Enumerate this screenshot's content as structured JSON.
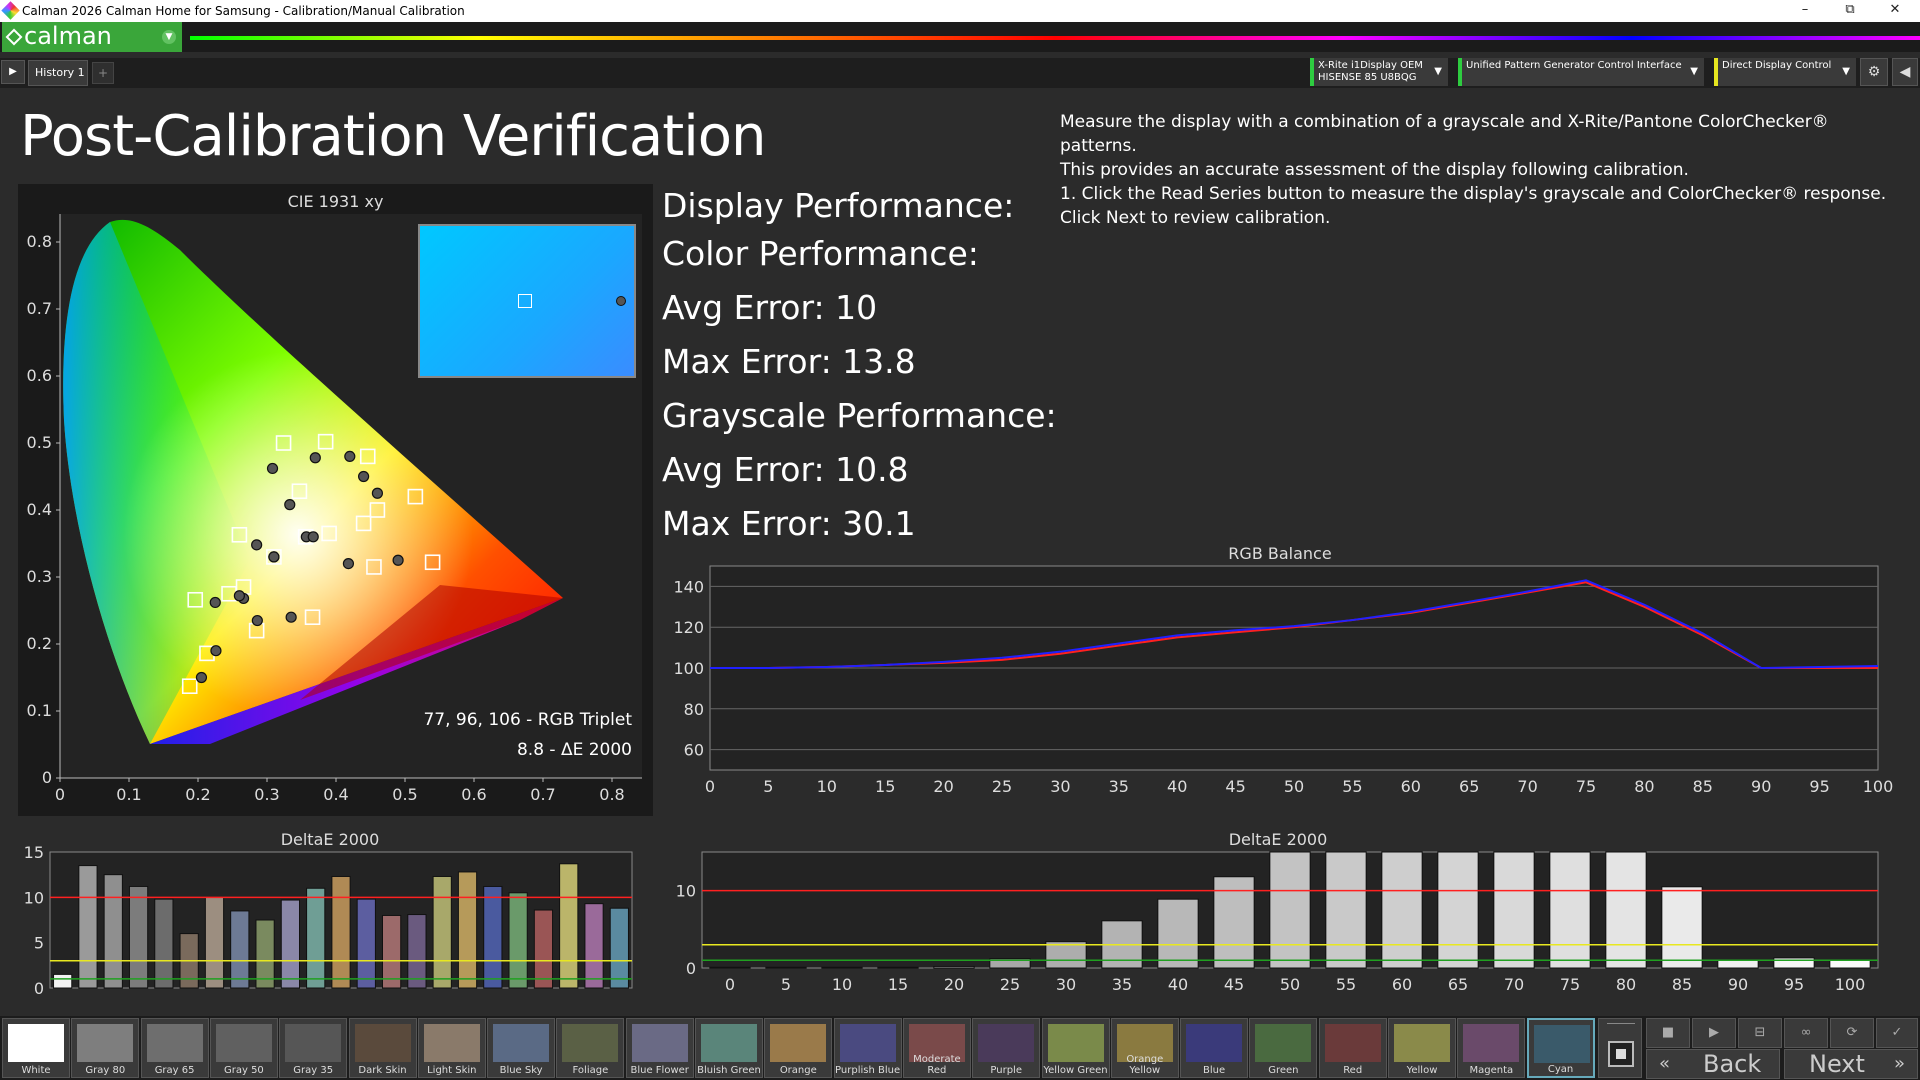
{
  "window": {
    "title": "Calman 2026 Calman Home for Samsung  - Calibration/Manual Calibration",
    "controls": [
      "–",
      "⧉",
      "✕"
    ]
  },
  "toolbar": {
    "brand": "calman",
    "tab_label": "History 1",
    "add_tab": "+",
    "devices": [
      {
        "line1": "X-Rite i1Display OEM",
        "line2": "HISENSE 85 U8BQG"
      },
      {
        "line1": "Unified Pattern Generator Control Interface",
        "line2": ""
      },
      {
        "line1": "Direct Display Control",
        "line2": ""
      }
    ]
  },
  "page": {
    "title": "Post-Calibration Verification",
    "instructions": [
      "Measure the display with a combination of a grayscale and X-Rite/Pantone ColorChecker® patterns.",
      "This provides an accurate assessment of the display following calibration.",
      "1. Click the Read Series button to measure the display's grayscale and ColorChecker® response.",
      "Click Next to review calibration."
    ]
  },
  "performance": {
    "display": "Display Performance:",
    "color": "Color Performance:",
    "color_avg": "Avg Error: 10",
    "color_max": "Max Error: 13.8",
    "grayscale": "Grayscale Performance:",
    "gray_avg": "Avg Error: 10.8",
    "gray_max": "Max Error: 30.1"
  },
  "cie": {
    "title": "CIE 1931 xy",
    "rgb_triplet": "77, 96, 106 - RGB Triplet",
    "delta_e": "8.8 - ΔE 2000",
    "x_ticks": [
      "0",
      "0.1",
      "0.2",
      "0.3",
      "0.4",
      "0.5",
      "0.6",
      "0.7",
      "0.8"
    ],
    "y_ticks": [
      "0",
      "0.1",
      "0.2",
      "0.3",
      "0.4",
      "0.5",
      "0.6",
      "0.7",
      "0.8"
    ],
    "targets": [
      [
        0.31,
        0.33
      ],
      [
        0.196,
        0.266
      ],
      [
        0.213,
        0.186
      ],
      [
        0.188,
        0.137
      ],
      [
        0.26,
        0.363
      ],
      [
        0.266,
        0.285
      ],
      [
        0.245,
        0.275
      ],
      [
        0.285,
        0.22
      ],
      [
        0.366,
        0.24
      ],
      [
        0.356,
        0.36
      ],
      [
        0.39,
        0.365
      ],
      [
        0.46,
        0.4
      ],
      [
        0.44,
        0.38
      ],
      [
        0.54,
        0.322
      ],
      [
        0.455,
        0.315
      ],
      [
        0.515,
        0.42
      ],
      [
        0.385,
        0.502
      ],
      [
        0.324,
        0.5
      ],
      [
        0.347,
        0.428
      ],
      [
        0.446,
        0.48
      ]
    ],
    "measured": [
      [
        0.31,
        0.33
      ],
      [
        0.225,
        0.262
      ],
      [
        0.226,
        0.19
      ],
      [
        0.205,
        0.15
      ],
      [
        0.285,
        0.348
      ],
      [
        0.266,
        0.268
      ],
      [
        0.26,
        0.272
      ],
      [
        0.286,
        0.235
      ],
      [
        0.335,
        0.24
      ],
      [
        0.357,
        0.36
      ],
      [
        0.367,
        0.36
      ],
      [
        0.46,
        0.425
      ],
      [
        0.42,
        0.48
      ],
      [
        0.49,
        0.325
      ],
      [
        0.418,
        0.32
      ],
      [
        0.44,
        0.45
      ],
      [
        0.37,
        0.478
      ],
      [
        0.308,
        0.462
      ],
      [
        0.333,
        0.408
      ],
      [
        0.31,
        0.33
      ]
    ],
    "inset_target": [
      0.32,
      0.52
    ],
    "inset_measured": [
      0.9,
      0.52
    ]
  },
  "chart_data": [
    {
      "type": "line",
      "title": "RGB Balance",
      "x": [
        0,
        5,
        10,
        15,
        20,
        25,
        30,
        35,
        40,
        45,
        50,
        55,
        60,
        65,
        70,
        75,
        80,
        85,
        90,
        95,
        100
      ],
      "ylim": [
        50,
        150
      ],
      "y_ticks": [
        60,
        80,
        100,
        120,
        140
      ],
      "series": [
        {
          "name": "",
          "color": "#ff2020",
          "values": [
            100,
            100,
            100.5,
            101.5,
            102.5,
            104,
            107,
            111,
            115,
            117.5,
            120,
            123.5,
            127,
            132,
            137,
            142,
            130,
            116,
            100,
            100,
            100
          ]
        },
        {
          "name": "",
          "color": "#2020ff",
          "values": [
            100,
            100,
            100.5,
            101.5,
            103,
            105,
            108,
            112,
            116,
            118.5,
            120.5,
            123.5,
            127.5,
            132.5,
            137.5,
            143,
            131,
            117,
            100,
            100.5,
            101
          ]
        }
      ]
    },
    {
      "type": "bar",
      "title": "DeltaE 2000",
      "ylim": [
        0,
        15
      ],
      "y_ticks": [
        0,
        5,
        10,
        15
      ],
      "categories": [
        "White",
        "Gray 80",
        "Gray 65",
        "Gray 50",
        "Gray 35",
        "Dark Skin",
        "Light Skin",
        "Blue Sky",
        "Foliage",
        "Blue Flower",
        "Bluish Green",
        "Orange",
        "Purplish Blue",
        "Moderate Red",
        "Purple",
        "Yellow Green",
        "Orange Yellow",
        "Blue",
        "Green",
        "Red",
        "Yellow",
        "Magenta",
        "Cyan"
      ],
      "values": [
        1.5,
        13.5,
        12.5,
        11.2,
        9.8,
        6,
        10,
        8.5,
        7.5,
        9.7,
        11,
        12.3,
        9.8,
        8,
        8.1,
        12.3,
        12.8,
        11.2,
        10.5,
        8.6,
        13.7,
        9.3,
        8.8
      ],
      "colors": [
        "#f2f2f2",
        "#9a9a9a",
        "#8f8f8f",
        "#7c7c7c",
        "#6c6c6c",
        "#7a6a5c",
        "#9c8e80",
        "#6d7a95",
        "#7a8a5f",
        "#8a87a8",
        "#6f9e95",
        "#b08a55",
        "#5c5ea0",
        "#9c6a6a",
        "#6a5a7f",
        "#a8a86a",
        "#b69a5a",
        "#4a5a9f",
        "#6a9a6a",
        "#9a5555",
        "#bbb56a",
        "#9a6a9a",
        "#5a8aa0"
      ],
      "thresholds": [
        {
          "value": 10,
          "color": "#ff2020"
        },
        {
          "value": 3,
          "color": "#e8e820"
        },
        {
          "value": 1,
          "color": "#20a020"
        }
      ]
    },
    {
      "type": "bar",
      "title": "DeltaE 2000",
      "ylim": [
        0,
        15
      ],
      "y_ticks": [
        0,
        10
      ],
      "categories": [
        "0",
        "5",
        "10",
        "15",
        "20",
        "25",
        "30",
        "35",
        "40",
        "45",
        "50",
        "55",
        "60",
        "65",
        "70",
        "75",
        "80",
        "85",
        "90",
        "95",
        "100"
      ],
      "values": [
        0.1,
        0.1,
        0.1,
        0.1,
        0.2,
        1.2,
        3.4,
        6.1,
        8.9,
        11.8,
        15,
        15,
        15,
        15,
        15,
        15,
        15,
        10.5,
        1,
        1.3,
        1
      ],
      "thresholds": [
        {
          "value": 10,
          "color": "#ff2020"
        },
        {
          "value": 3,
          "color": "#e8e820"
        },
        {
          "value": 1,
          "color": "#20a020"
        }
      ]
    }
  ],
  "swatches": [
    {
      "label": "White",
      "color": "#ffffff"
    },
    {
      "label": "Gray 80",
      "color": "#7e7e7e"
    },
    {
      "label": "Gray 65",
      "color": "#6e6e6e"
    },
    {
      "label": "Gray 50",
      "color": "#606060"
    },
    {
      "label": "Gray 35",
      "color": "#565656"
    },
    {
      "label": "Dark Skin",
      "color": "#5a4a3c"
    },
    {
      "label": "Light Skin",
      "color": "#8a7a6a"
    },
    {
      "label": "Blue Sky",
      "color": "#5a6a85"
    },
    {
      "label": "Foliage",
      "color": "#5a6045"
    },
    {
      "label": "Blue Flower",
      "color": "#6a6a85"
    },
    {
      "label": "Bluish Green",
      "color": "#5a857a"
    },
    {
      "label": "Orange",
      "color": "#9a7a4a"
    },
    {
      "label": "Purplish Blue",
      "color": "#4a4a80"
    },
    {
      "label": "Moderate Red",
      "color": "#7a4a4a"
    },
    {
      "label": "Purple",
      "color": "#4a3a5a"
    },
    {
      "label": "Yellow Green",
      "color": "#7a8a4a"
    },
    {
      "label": "Orange Yellow",
      "color": "#8a7a40"
    },
    {
      "label": "Blue",
      "color": "#3a3a7a"
    },
    {
      "label": "Green",
      "color": "#4a6a40"
    },
    {
      "label": "Red",
      "color": "#6a3a3a"
    },
    {
      "label": "Yellow",
      "color": "#8a8a4a"
    },
    {
      "label": "Magenta",
      "color": "#6a4a6a"
    },
    {
      "label": "Cyan",
      "color": "#3a5a6a"
    }
  ],
  "nav": {
    "back": "Back",
    "next": "Next"
  }
}
